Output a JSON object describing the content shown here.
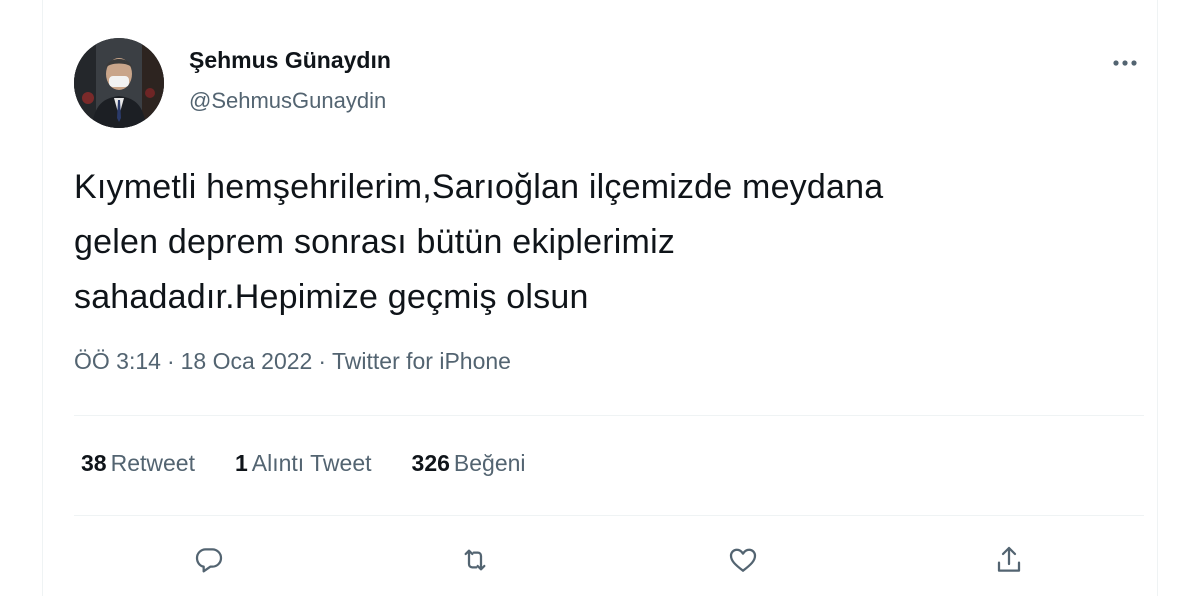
{
  "author": {
    "name": "Şehmus Günaydın",
    "handle": "@SehmusGunaydin",
    "avatar": "profile-photo"
  },
  "tweet": {
    "text": "Kıymetli hemşehrilerim,Sarıoğlan ilçemizde meydana\ngelen deprem sonrası bütün ekiplerimiz\nsahadadır.Hepimize geçmiş olsun"
  },
  "meta": {
    "time": "ÖÖ 3:14",
    "separator": "·",
    "date": "18 Oca 2022",
    "source": "Twitter for iPhone"
  },
  "stats": {
    "retweets": {
      "count": "38",
      "label": "Retweet"
    },
    "quotes": {
      "count": "1",
      "label": "Alıntı Tweet"
    },
    "likes": {
      "count": "326",
      "label": "Beğeni"
    }
  },
  "icons": {
    "more": "more-horizontal-icon",
    "reply": "reply-icon",
    "retweet": "retweet-icon",
    "like": "heart-icon",
    "share": "share-icon"
  },
  "colors": {
    "text_primary": "#0f1419",
    "text_secondary": "#536471",
    "divider": "#eff3f4"
  }
}
